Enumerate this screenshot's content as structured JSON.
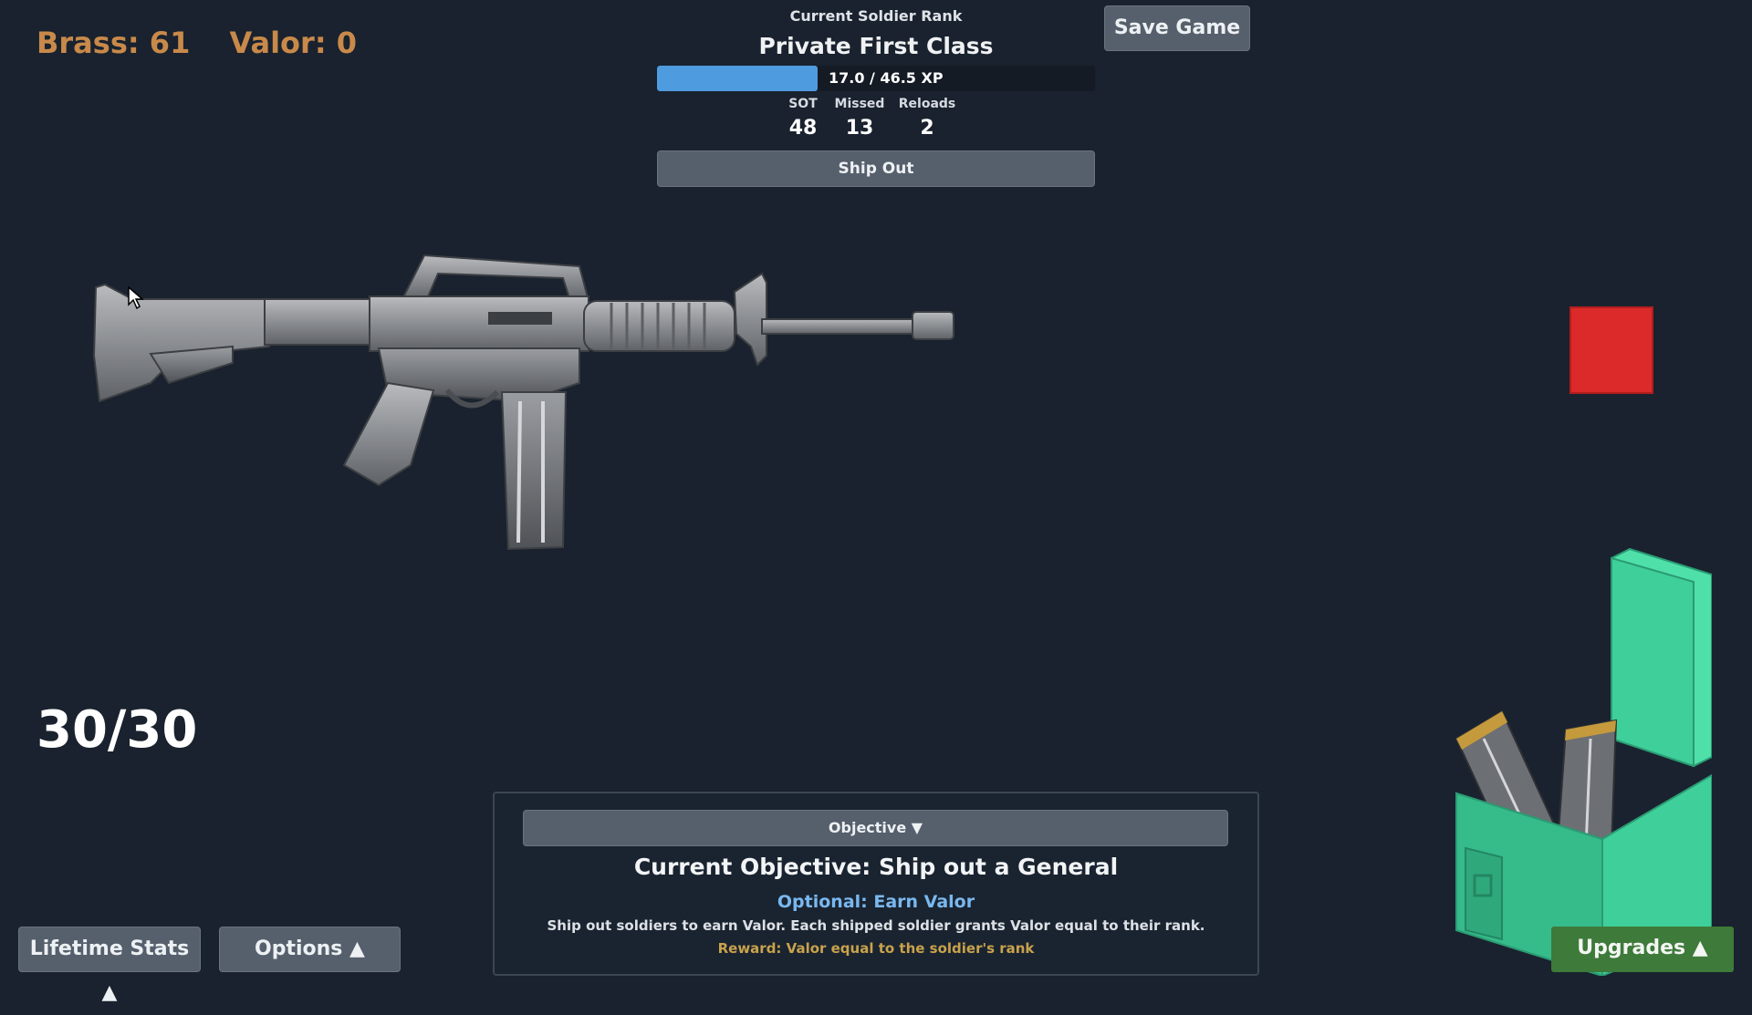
{
  "currency": {
    "brass": "Brass: 61",
    "valor": "Valor: 0"
  },
  "rank": {
    "caption": "Current Soldier Rank",
    "name": "Private First Class",
    "xp_text": "17.0 / 46.5 XP",
    "xp_progress": 0.366
  },
  "stats": [
    {
      "label": "SOT",
      "value": "48"
    },
    {
      "label": "Missed",
      "value": "13"
    },
    {
      "label": "Reloads",
      "value": "2"
    }
  ],
  "buttons": {
    "ship_out": "Ship Out",
    "save_game": "Save Game",
    "lifetime_stats": "Lifetime Stats ▲",
    "options": "Options ▲",
    "upgrades": "Upgrades ▲"
  },
  "ammo": "30/30",
  "objective": {
    "toggle_label": "Objective ▼",
    "title": "Current Objective: Ship out a General",
    "optional": "Optional: Earn Valor",
    "description": "Ship out soldiers to earn Valor. Each shipped soldier grants Valor equal to their rank.",
    "reward": "Reward: Valor equal to the soldier's rank"
  },
  "colors": {
    "background": "#19222e",
    "brass_text": "#c8894a",
    "xp_fill": "#4f9be0",
    "target": "#dc2a2a",
    "upgrades_button": "#3e7a3a",
    "ammo_box": "#3fcf9a"
  },
  "icons": {
    "rifle": "m16-rifle-image",
    "target": "red-target-square",
    "ammo_box": "ammo-can-with-magazines",
    "cursor": "mouse-pointer-icon"
  }
}
